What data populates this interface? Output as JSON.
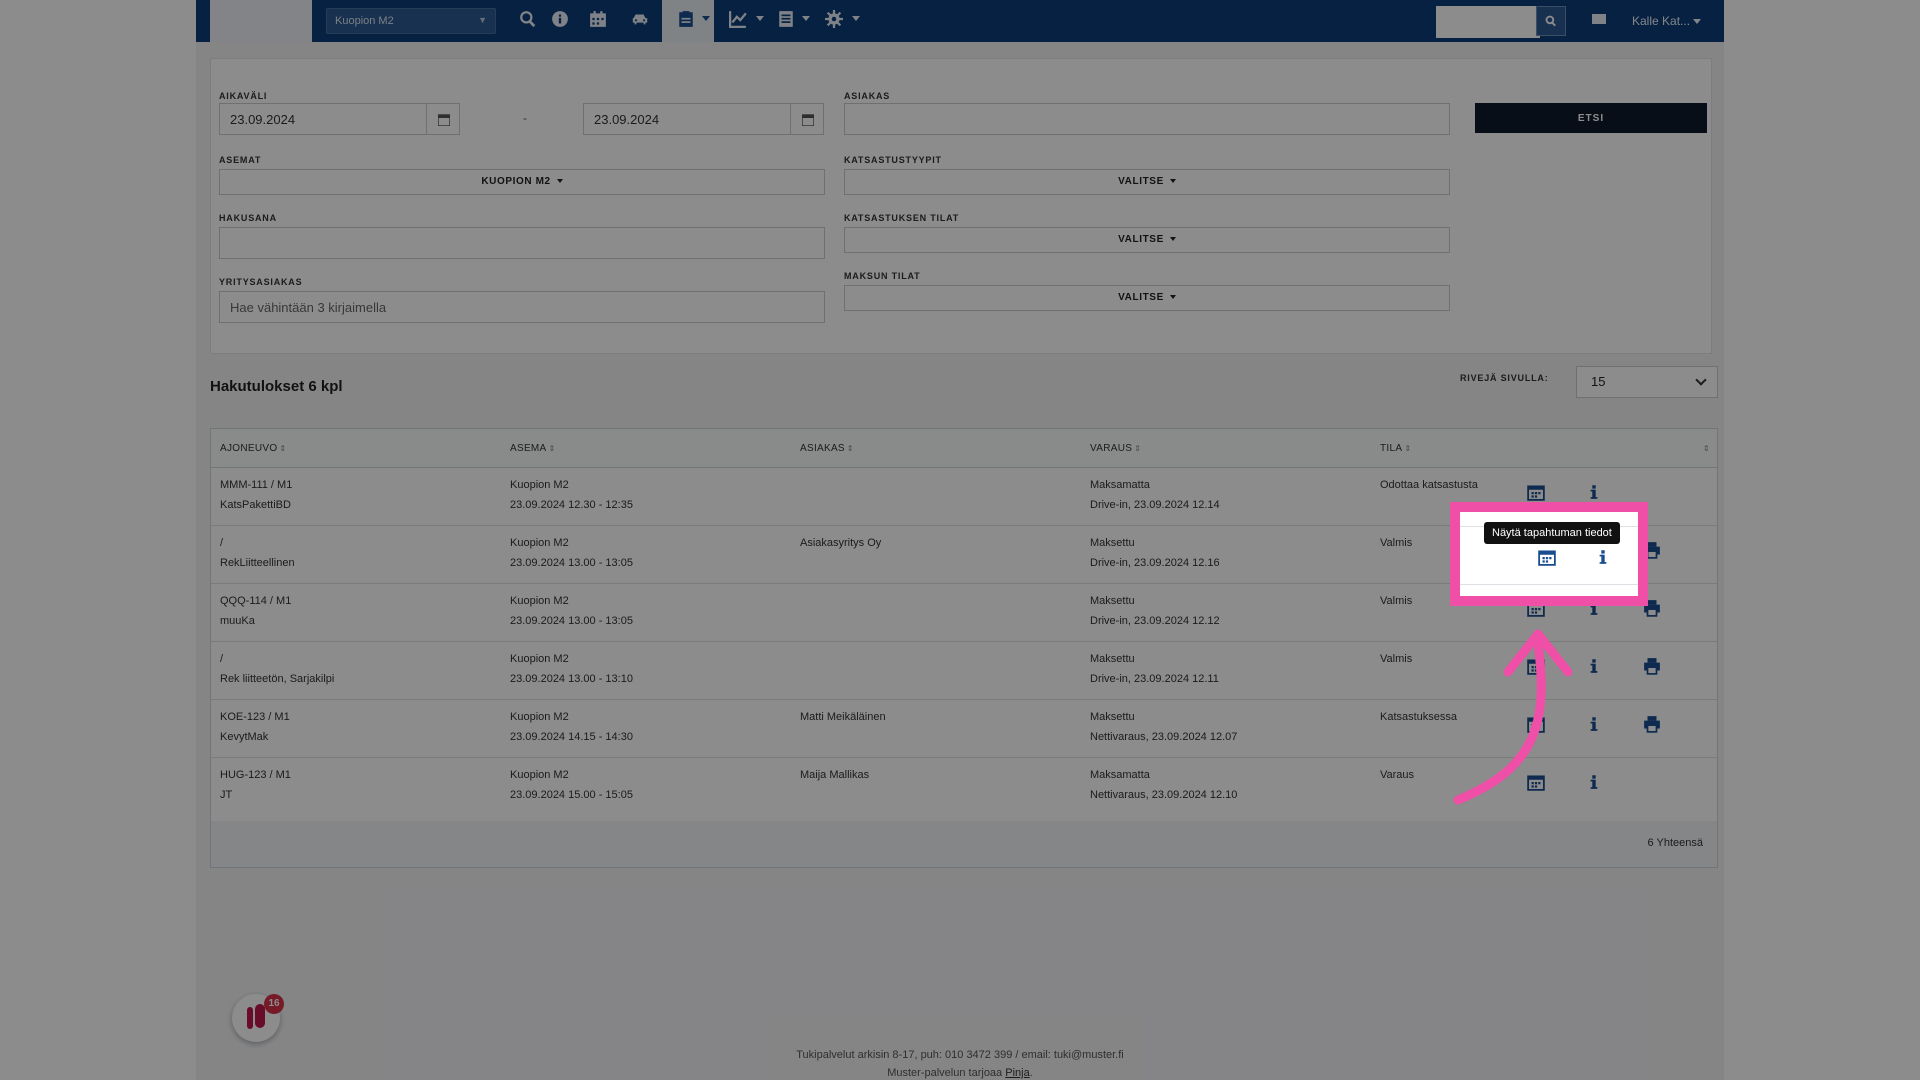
{
  "navbar": {
    "station_select": "Kuopion M2",
    "search_placeholder": "",
    "user_label": "Kalle Kat...",
    "icons": [
      "search-icon",
      "info-icon",
      "calendar-icon",
      "car-icon",
      "clipboard-icon",
      "chart-icon",
      "document-icon",
      "gear-icon",
      "mail-icon"
    ]
  },
  "search": {
    "aikavali_label": "AIKAVÄLI",
    "date_from": "23.09.2024",
    "date_to": "23.09.2024",
    "dash": "-",
    "asiakas_label": "ASIAKAS",
    "asiakas_value": "",
    "etsi_label": "ETSI",
    "asemat_label": "ASEMAT",
    "asemat_value": "KUOPION M2",
    "katsastustyypit_label": "KATSASTUSTYYPIT",
    "katsastustyypit_value": "VALITSE",
    "hakusana_label": "HAKUSANA",
    "hakusana_value": "",
    "tilat_label": "KATSASTUKSEN TILAT",
    "tilat_value": "VALITSE",
    "yritys_label": "YRITYSASIAKAS",
    "yritys_placeholder": "Hae vähintään 3 kirjaimella",
    "maksu_label": "MAKSUN TILAT",
    "maksu_value": "VALITSE"
  },
  "results": {
    "title": "Hakutulokset 6 kpl",
    "rows_label": "RIVEJÄ SIVULLA:",
    "rows_value": "15",
    "columns": [
      "AJONEUVO",
      "ASEMA",
      "ASIAKAS",
      "VARAUS",
      "TILA"
    ],
    "rows": [
      {
        "vehicle": "MMM-111 / M1",
        "vehicle2": "KatsPakettiBD",
        "station": "Kuopion M2",
        "time": "23.09.2024 12.30 - 12:35",
        "customer": "",
        "payment": "Maksamatta",
        "booking": "Drive-in, 23.09.2024 12.14",
        "status": "Odottaa katsastusta",
        "print": false
      },
      {
        "vehicle": "/",
        "vehicle2": "RekLiitteellinen",
        "station": "Kuopion M2",
        "time": "23.09.2024 13.00 - 13:05",
        "customer": "Asiakasyritys Oy",
        "payment": "Maksettu",
        "booking": "Drive-in, 23.09.2024 12.16",
        "status": "Valmis",
        "print": true
      },
      {
        "vehicle": "QQQ-114 / M1",
        "vehicle2": "muuKa",
        "station": "Kuopion M2",
        "time": "23.09.2024 13.00 - 13:05",
        "customer": "",
        "payment": "Maksettu",
        "booking": "Drive-in, 23.09.2024 12.12",
        "status": "Valmis",
        "print": true
      },
      {
        "vehicle": "/",
        "vehicle2": "Rek liitteetön, Sarjakilpi",
        "station": "Kuopion M2",
        "time": "23.09.2024 13.00 - 13:10",
        "customer": "",
        "payment": "Maksettu",
        "booking": "Drive-in, 23.09.2024 12.11",
        "status": "Valmis",
        "print": true
      },
      {
        "vehicle": "KOE-123 / M1",
        "vehicle2": "KevytMak",
        "station": "Kuopion M2",
        "time": "23.09.2024 14.15 - 14:30",
        "customer": "Matti Meikäläinen",
        "payment": "Maksettu",
        "booking": "Nettivaraus, 23.09.2024 12.07",
        "status": "Katsastuksessa",
        "print": true
      },
      {
        "vehicle": "HUG-123 / M1",
        "vehicle2": "JT",
        "station": "Kuopion M2",
        "time": "23.09.2024 15.00 - 15:05",
        "customer": "Maija Mallikas",
        "payment": "Maksamatta",
        "booking": "Nettivaraus, 23.09.2024 12.10",
        "status": "Varaus",
        "print": false
      }
    ],
    "total": "6 Yhteensä"
  },
  "tooltip": "Näytä tapahtuman tiedot",
  "footer": {
    "line1": "Tukipalvelut arkisin 8-17, puh: 010 3472 399 / email: tuki@muster.fi",
    "line2_prefix": "Muster-palvelun tarjoaa ",
    "line2_link": "Pinja",
    "line2_suffix": "."
  },
  "chat": {
    "badge": "16"
  },
  "colors": {
    "navbar": "#0d3c78",
    "highlight": "#ef4fa6",
    "button": "#0e1a2c",
    "icon_blue": "#1a4d8f"
  }
}
